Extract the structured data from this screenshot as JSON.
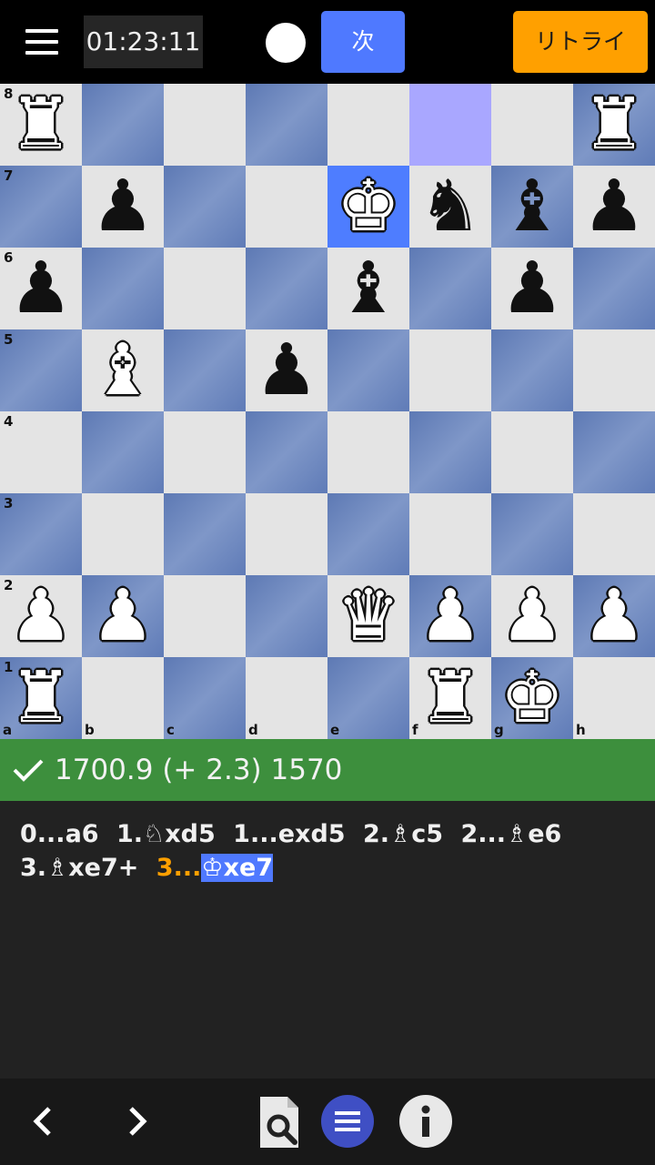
{
  "header": {
    "timer": "01:23:11",
    "next_label": "次",
    "retry_label": "リトライ",
    "turn_color": "white"
  },
  "board": {
    "ranks": [
      "8",
      "7",
      "6",
      "5",
      "4",
      "3",
      "2",
      "1"
    ],
    "files": [
      "a",
      "b",
      "c",
      "d",
      "e",
      "f",
      "g",
      "h"
    ],
    "highlight_squares": [
      "f8"
    ],
    "selected_square": "e7",
    "pieces": [
      {
        "square": "a8",
        "glyph": "♜",
        "color": "w",
        "name": "white-rook"
      },
      {
        "square": "h8",
        "glyph": "♜",
        "color": "w",
        "name": "white-rook"
      },
      {
        "square": "b7",
        "glyph": "♟",
        "color": "b",
        "name": "black-pawn"
      },
      {
        "square": "e7",
        "glyph": "♚",
        "color": "w",
        "name": "white-king"
      },
      {
        "square": "f7",
        "glyph": "♞",
        "color": "b",
        "name": "black-knight"
      },
      {
        "square": "g7",
        "glyph": "♝",
        "color": "b",
        "name": "black-bishop"
      },
      {
        "square": "h7",
        "glyph": "♟",
        "color": "b",
        "name": "black-pawn"
      },
      {
        "square": "a6",
        "glyph": "♟",
        "color": "b",
        "name": "black-pawn"
      },
      {
        "square": "e6",
        "glyph": "♝",
        "color": "b",
        "name": "black-bishop"
      },
      {
        "square": "g6",
        "glyph": "♟",
        "color": "b",
        "name": "black-pawn"
      },
      {
        "square": "b5",
        "glyph": "♝",
        "color": "w",
        "name": "white-bishop"
      },
      {
        "square": "d5",
        "glyph": "♟",
        "color": "b",
        "name": "black-pawn"
      },
      {
        "square": "a2",
        "glyph": "♟",
        "color": "w",
        "name": "white-pawn"
      },
      {
        "square": "b2",
        "glyph": "♟",
        "color": "w",
        "name": "white-pawn"
      },
      {
        "square": "e2",
        "glyph": "♛",
        "color": "w",
        "name": "white-queen"
      },
      {
        "square": "f2",
        "glyph": "♟",
        "color": "w",
        "name": "white-pawn"
      },
      {
        "square": "g2",
        "glyph": "♟",
        "color": "w",
        "name": "white-pawn"
      },
      {
        "square": "h2",
        "glyph": "♟",
        "color": "w",
        "name": "white-pawn"
      },
      {
        "square": "a1",
        "glyph": "♜",
        "color": "w",
        "name": "white-rook"
      },
      {
        "square": "f1",
        "glyph": "♜",
        "color": "w",
        "name": "white-rook"
      },
      {
        "square": "g1",
        "glyph": "♚",
        "color": "w",
        "name": "white-king"
      }
    ]
  },
  "evaluation": {
    "icon": "check-icon",
    "text": "1700.9 (+ 2.3) 1570"
  },
  "moves": [
    {
      "num": "0...",
      "san": "a6"
    },
    {
      "num": "1.",
      "san": "♘xd5"
    },
    {
      "num": "1...",
      "san": "exd5"
    },
    {
      "num": "2.",
      "san": "♗c5"
    },
    {
      "num": "2...",
      "san": "♗e6"
    },
    {
      "num": "3.",
      "san": "♗xe7+"
    },
    {
      "num": "3...",
      "san": "♔xe7",
      "current": true
    }
  ],
  "bottom_bar": {
    "icons": [
      "chevron-left-icon",
      "chevron-right-icon",
      "search-document-icon",
      "list-icon",
      "info-icon"
    ],
    "accent_color": "#3f4fc4"
  }
}
